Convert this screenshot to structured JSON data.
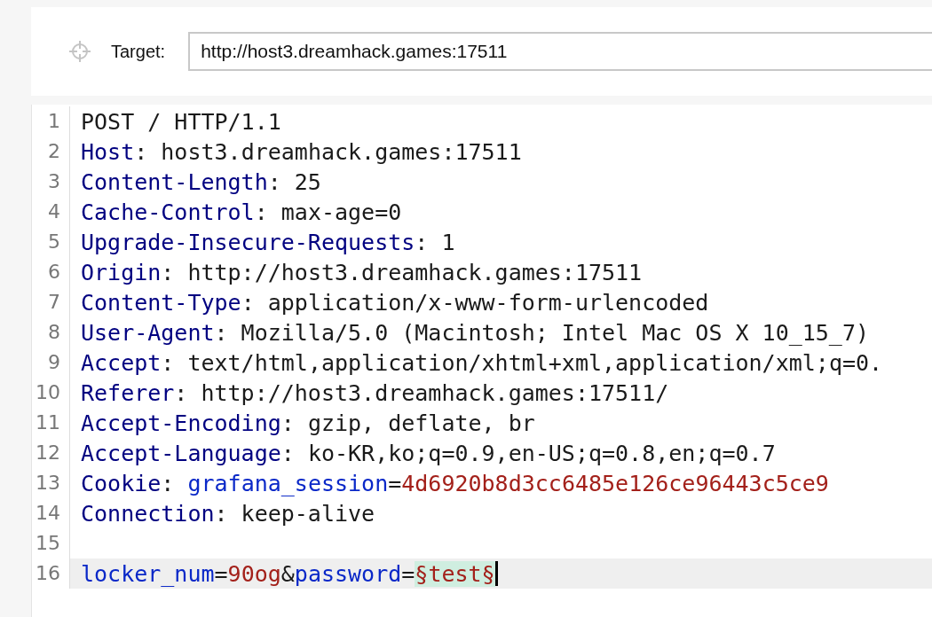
{
  "target": {
    "label": "Target:",
    "value": "http://host3.dreamhack.games:17511"
  },
  "editor": {
    "lines": [
      {
        "number": "1",
        "selected": false,
        "tokens": [
          {
            "kind": "text",
            "text": "POST / HTTP/1.1"
          }
        ]
      },
      {
        "number": "2",
        "selected": false,
        "tokens": [
          {
            "kind": "name",
            "text": "Host"
          },
          {
            "kind": "text",
            "text": ": host3.dreamhack.games:17511"
          }
        ]
      },
      {
        "number": "3",
        "selected": false,
        "tokens": [
          {
            "kind": "name",
            "text": "Content-Length"
          },
          {
            "kind": "text",
            "text": ": 25"
          }
        ]
      },
      {
        "number": "4",
        "selected": false,
        "tokens": [
          {
            "kind": "name",
            "text": "Cache-Control"
          },
          {
            "kind": "text",
            "text": ": max-age=0"
          }
        ]
      },
      {
        "number": "5",
        "selected": false,
        "tokens": [
          {
            "kind": "name",
            "text": "Upgrade-Insecure-Requests"
          },
          {
            "kind": "text",
            "text": ": 1"
          }
        ]
      },
      {
        "number": "6",
        "selected": false,
        "tokens": [
          {
            "kind": "name",
            "text": "Origin"
          },
          {
            "kind": "text",
            "text": ": http://host3.dreamhack.games:17511"
          }
        ]
      },
      {
        "number": "7",
        "selected": false,
        "tokens": [
          {
            "kind": "name",
            "text": "Content-Type"
          },
          {
            "kind": "text",
            "text": ": application/x-www-form-urlencoded"
          }
        ]
      },
      {
        "number": "8",
        "selected": false,
        "tokens": [
          {
            "kind": "name",
            "text": "User-Agent"
          },
          {
            "kind": "text",
            "text": ": Mozilla/5.0 (Macintosh; Intel Mac OS X 10_15_7)"
          }
        ]
      },
      {
        "number": "9",
        "selected": false,
        "tokens": [
          {
            "kind": "name",
            "text": "Accept"
          },
          {
            "kind": "text",
            "text": ": text/html,application/xhtml+xml,application/xml;q=0."
          }
        ]
      },
      {
        "number": "10",
        "selected": false,
        "tokens": [
          {
            "kind": "name",
            "text": "Referer"
          },
          {
            "kind": "text",
            "text": ": http://host3.dreamhack.games:17511/"
          }
        ]
      },
      {
        "number": "11",
        "selected": false,
        "tokens": [
          {
            "kind": "name",
            "text": "Accept-Encoding"
          },
          {
            "kind": "text",
            "text": ": gzip, deflate, br"
          }
        ]
      },
      {
        "number": "12",
        "selected": false,
        "tokens": [
          {
            "kind": "name",
            "text": "Accept-Language"
          },
          {
            "kind": "text",
            "text": ": ko-KR,ko;q=0.9,en-US;q=0.8,en;q=0.7"
          }
        ]
      },
      {
        "number": "13",
        "selected": false,
        "tokens": [
          {
            "kind": "name",
            "text": "Cookie"
          },
          {
            "kind": "text",
            "text": ": "
          },
          {
            "kind": "param",
            "text": "grafana_session"
          },
          {
            "kind": "text",
            "text": "="
          },
          {
            "kind": "value",
            "text": "4d6920b8d3cc6485e126ce96443c5ce9"
          }
        ]
      },
      {
        "number": "14",
        "selected": false,
        "tokens": [
          {
            "kind": "name",
            "text": "Connection"
          },
          {
            "kind": "text",
            "text": ": keep-alive"
          }
        ]
      },
      {
        "number": "15",
        "selected": false
      },
      {
        "number": "16",
        "selected": true,
        "tokens": [
          {
            "kind": "param",
            "text": "locker_num"
          },
          {
            "kind": "text",
            "text": "="
          },
          {
            "kind": "value",
            "text": "90og"
          },
          {
            "kind": "text",
            "text": "&"
          },
          {
            "kind": "param",
            "text": "password"
          },
          {
            "kind": "text",
            "text": "="
          },
          {
            "kind": "payload",
            "text": "§test§"
          }
        ]
      }
    ]
  }
}
